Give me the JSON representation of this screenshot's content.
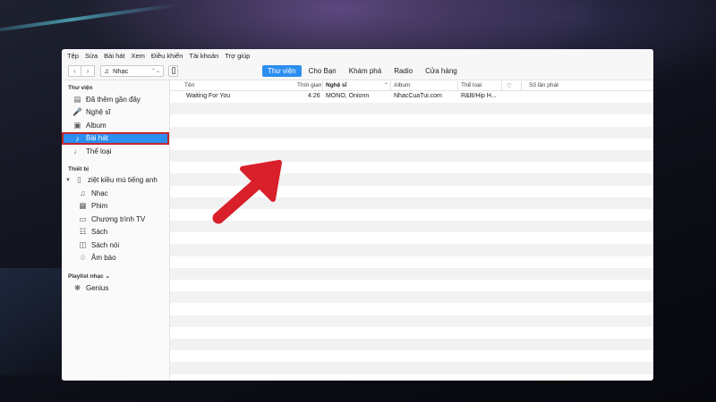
{
  "menu": [
    "Tệp",
    "Sửa",
    "Bài hát",
    "Xem",
    "Điều khiển",
    "Tài khoản",
    "Trợ giúp"
  ],
  "toolbar": {
    "back_icon": "chevron-left-icon",
    "forward_icon": "chevron-right-icon",
    "media_selector": {
      "icon": "music-note-icon",
      "label": "Nhạc",
      "arrow": "⌃⌄"
    },
    "device_icon": "phone-icon"
  },
  "tabs": [
    {
      "label": "Thư viện",
      "active": true
    },
    {
      "label": "Cho Bạn",
      "active": false
    },
    {
      "label": "Khám phá",
      "active": false
    },
    {
      "label": "Radio",
      "active": false
    },
    {
      "label": "Cửa hàng",
      "active": false
    }
  ],
  "sidebar": {
    "library_header": "Thư viện",
    "library_items": [
      {
        "label": "Đã thêm gần đây",
        "icon": "recently-added-icon"
      },
      {
        "label": "Nghệ sĩ",
        "icon": "microphone-icon"
      },
      {
        "label": "Album",
        "icon": "album-icon"
      },
      {
        "label": "Bài hát",
        "icon": "music-note-icon",
        "selected": true
      },
      {
        "label": "Thể loại",
        "icon": "genre-icon"
      }
    ],
    "devices_header": "Thiết bị",
    "device_name": "ziệt kiều mù tiếng anh",
    "device_items": [
      {
        "label": "Nhạc",
        "icon": "music-note-icon"
      },
      {
        "label": "Phim",
        "icon": "film-icon"
      },
      {
        "label": "Chương trình TV",
        "icon": "tv-icon"
      },
      {
        "label": "Sách",
        "icon": "book-icon"
      },
      {
        "label": "Sách nói",
        "icon": "audiobook-icon"
      },
      {
        "label": "Âm báo",
        "icon": "bell-icon"
      }
    ],
    "playlists_header": "Playlist nhạc ⌄",
    "playlist_items": [
      {
        "label": "Genius",
        "icon": "genius-icon"
      }
    ]
  },
  "table": {
    "columns": {
      "name": "Tên",
      "time": "Thời gian",
      "artist": "Nghệ sĩ",
      "album": "Album",
      "genre": "Thể loại",
      "love": "♡",
      "plays": "Số lần phát"
    },
    "rows": [
      {
        "name": "Waiting For You",
        "time": "4:26",
        "artist": "MONO, Onionn",
        "album": "NhacCuaTui.com",
        "genre": "R&B/Hip H..."
      }
    ]
  },
  "colors": {
    "accent": "#2b8ef0",
    "highlight_border": "#c0282d",
    "annotation_arrow": "#d81f2a"
  },
  "annotation": {
    "icon": "red-arrow-annotation-icon"
  }
}
